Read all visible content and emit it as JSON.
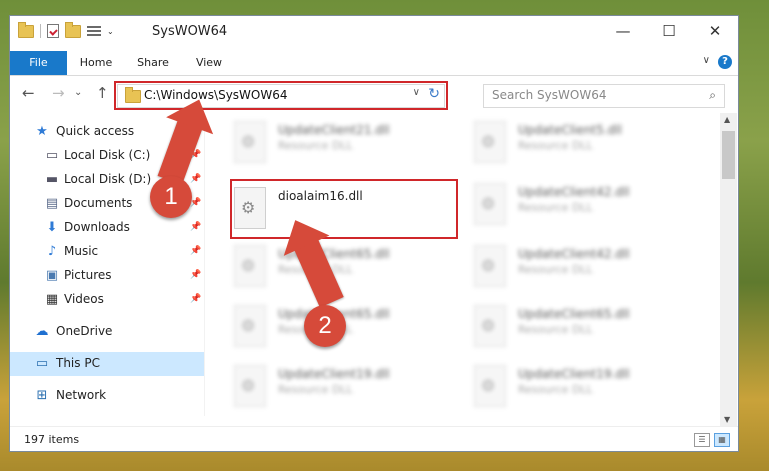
{
  "window": {
    "title": "SysWOW64",
    "minimize": "—",
    "maximize": "☐",
    "close": "✕"
  },
  "ribbon": {
    "tabs": [
      "File",
      "Home",
      "Share",
      "View"
    ],
    "help": "?",
    "expand": "∨"
  },
  "nav": {
    "back": "←",
    "forward": "→",
    "up": "↑",
    "recent": "⌄",
    "address": "C:\\Windows\\SysWOW64",
    "address_dropdown": "∨",
    "refresh": "↻",
    "search_placeholder": "Search SysWOW64",
    "search_icon": "⌕"
  },
  "sidebar": {
    "items": [
      {
        "label": "Quick access",
        "icon": "star-icon"
      },
      {
        "label": "Local Disk (C:)",
        "icon": "drive-icon",
        "pinned": true
      },
      {
        "label": "Local Disk (D:)",
        "icon": "drive-icon",
        "pinned": true
      },
      {
        "label": "Documents",
        "icon": "documents-icon",
        "pinned": true
      },
      {
        "label": "Downloads",
        "icon": "download-icon",
        "pinned": true
      },
      {
        "label": "Music",
        "icon": "music-icon",
        "pinned": true
      },
      {
        "label": "Pictures",
        "icon": "pictures-icon",
        "pinned": true
      },
      {
        "label": "Videos",
        "icon": "videos-icon",
        "pinned": true
      },
      {
        "label": "OneDrive",
        "icon": "cloud-icon"
      },
      {
        "label": "This PC",
        "icon": "computer-icon",
        "selected": true
      },
      {
        "label": "Network",
        "icon": "network-icon"
      }
    ],
    "pin_glyph": "📌"
  },
  "files": {
    "left": [
      {
        "name": "UpdateClient21.dll",
        "desc": "Resource DLL"
      },
      {
        "name": "dioalaim16.dll",
        "desc": ""
      },
      {
        "name": "UpdateClient65.dll",
        "desc": "Resource DLL"
      },
      {
        "name": "UpdateClient65.dll",
        "desc": "Resource DLL"
      },
      {
        "name": "UpdateClient19.dll",
        "desc": "Resource DLL"
      }
    ],
    "right": [
      {
        "name": "UpdateClient5.dll",
        "desc": "Resource DLL"
      },
      {
        "name": "UpdateClient42.dll",
        "desc": "Resource DLL"
      },
      {
        "name": "UpdateClient42.dll",
        "desc": "Resource DLL"
      },
      {
        "name": "UpdateClient65.dll",
        "desc": "Resource DLL"
      },
      {
        "name": "UpdateClient19.dll",
        "desc": "Resource DLL"
      }
    ]
  },
  "status": {
    "count": "197 items",
    "details_view": "☰",
    "tiles_view": "▦"
  },
  "markers": {
    "one": "1",
    "two": "2"
  },
  "colors": {
    "accent": "#1979ca",
    "highlight": "#d0272a",
    "marker": "#d64a3a",
    "selection": "#cce8ff"
  }
}
